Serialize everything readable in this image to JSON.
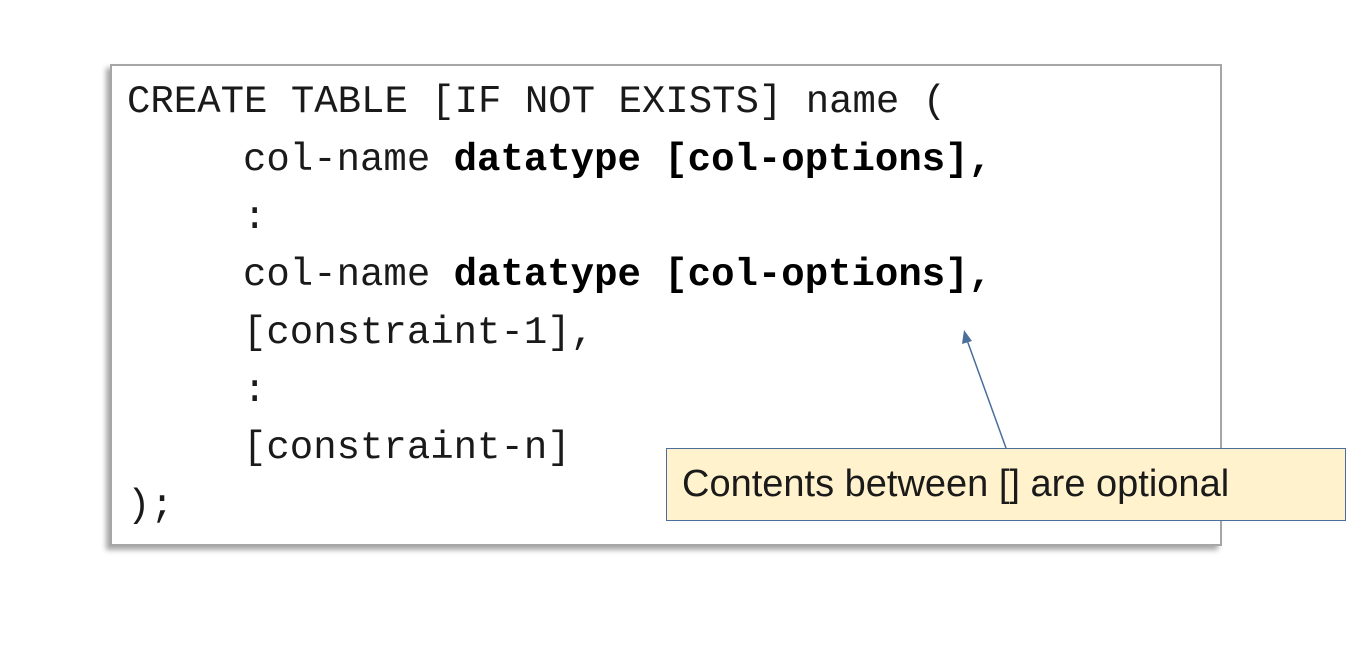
{
  "code": {
    "line1": "CREATE TABLE [IF NOT EXISTS] name (",
    "line2_plain": "col-name ",
    "line2_bold": "datatype [col-options]",
    "line2_tail": ",",
    "line3": ":",
    "line4_plain": "col-name ",
    "line4_bold": "datatype [col-options]",
    "line4_tail": ",",
    "line5": "[constraint-1],",
    "line6": ":",
    "line7": "[constraint-n]",
    "line8": ");"
  },
  "callout": {
    "text": "Contents between [] are optional",
    "background": "#fff2cc",
    "border_color": "#4a6f9c"
  },
  "arrow": {
    "color": "#4a6f9c"
  }
}
